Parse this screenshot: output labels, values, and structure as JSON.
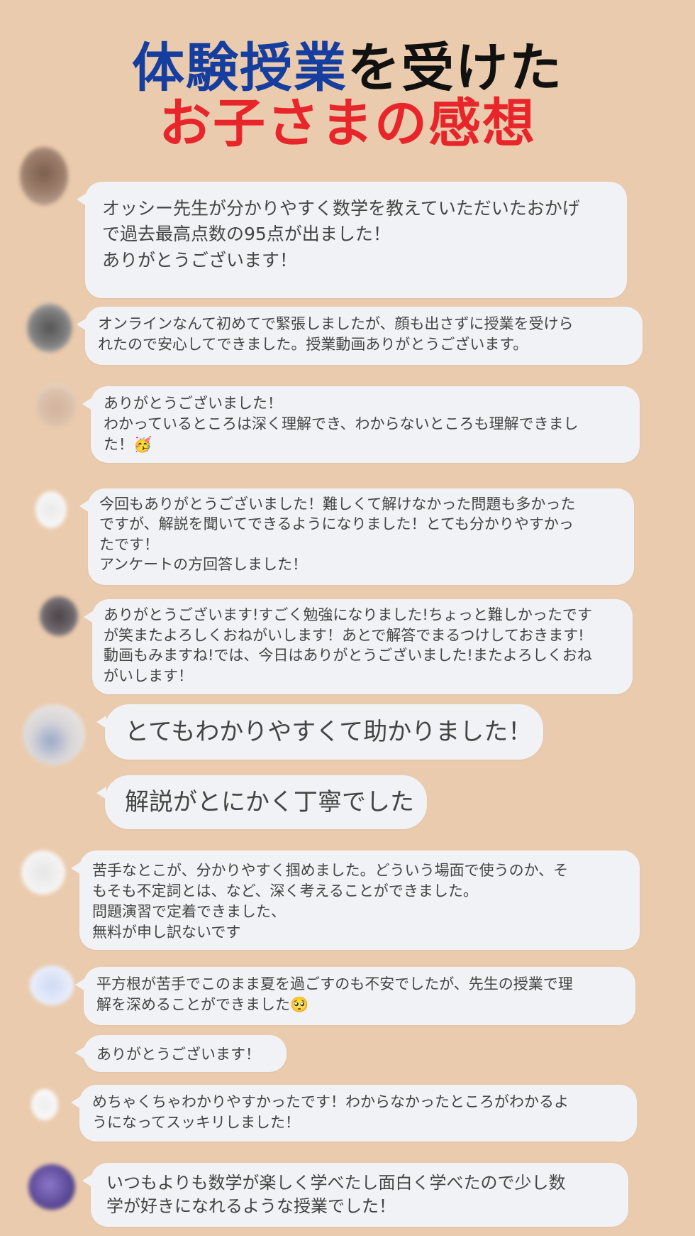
{
  "title": {
    "line1_blue": "体験授業",
    "line1_black": "を受けた",
    "line2": "お子さまの感想"
  },
  "comments": [
    {
      "lines": [
        "オッシー先生が分かりやすく数学を教えていただいたおかげ",
        "で過去最高点数の95点が出ました！",
        "ありがとうございます！"
      ]
    },
    {
      "lines": [
        "オンラインなんて初めてで緊張しましたが、顔も出さずに授業を受けら",
        "れたので安心してできました。授業動画ありがとうございます。"
      ]
    },
    {
      "lines": [
        "ありがとうございました！",
        "わかっているところは深く理解でき、わからないところも理解できまし",
        "た！🥳"
      ]
    },
    {
      "lines": [
        "今回もありがとうございました！難しくて解けなかった問題も多かった",
        "ですが、解説を聞いてできるようになりました！とても分かりやすかっ",
        "たです！",
        "アンケートの方回答しました！"
      ]
    },
    {
      "lines": [
        "ありがとうございます!すごく勉強になりました!ちょっと難しかったです",
        "が笑またよろしくおねがいします！あとで解答でまるつけしておきます!",
        "動画もみますね!では、今日はありがとうございました!またよろしくおね",
        "がいします！"
      ]
    },
    {
      "lines": [
        "とてもわかりやすくて助かりました！"
      ]
    },
    {
      "lines": [
        "解説がとにかく丁寧でした"
      ]
    },
    {
      "lines": [
        "苦手なとこが、分かりやすく掴めました。どういう場面で使うのか、そ",
        "もそも不定詞とは、など、深く考えることができました。",
        "問題演習で定着できました、",
        "無料が申し訳ないです"
      ]
    },
    {
      "lines": [
        "平方根が苦手でこのまま夏を過ごすのも不安でしたが、先生の授業で理",
        "解を深めることができました🥺"
      ]
    },
    {
      "lines": [
        "ありがとうございます！"
      ]
    },
    {
      "lines": [
        "めちゃくちゃわかりやすかったです！わからなかったところがわかるよ",
        "うになってスッキリしました！"
      ]
    },
    {
      "lines": [
        "いつもよりも数学が楽しく学べたし面白く学べたので少し数",
        "学が好きになれるような授業でした！"
      ]
    }
  ]
}
